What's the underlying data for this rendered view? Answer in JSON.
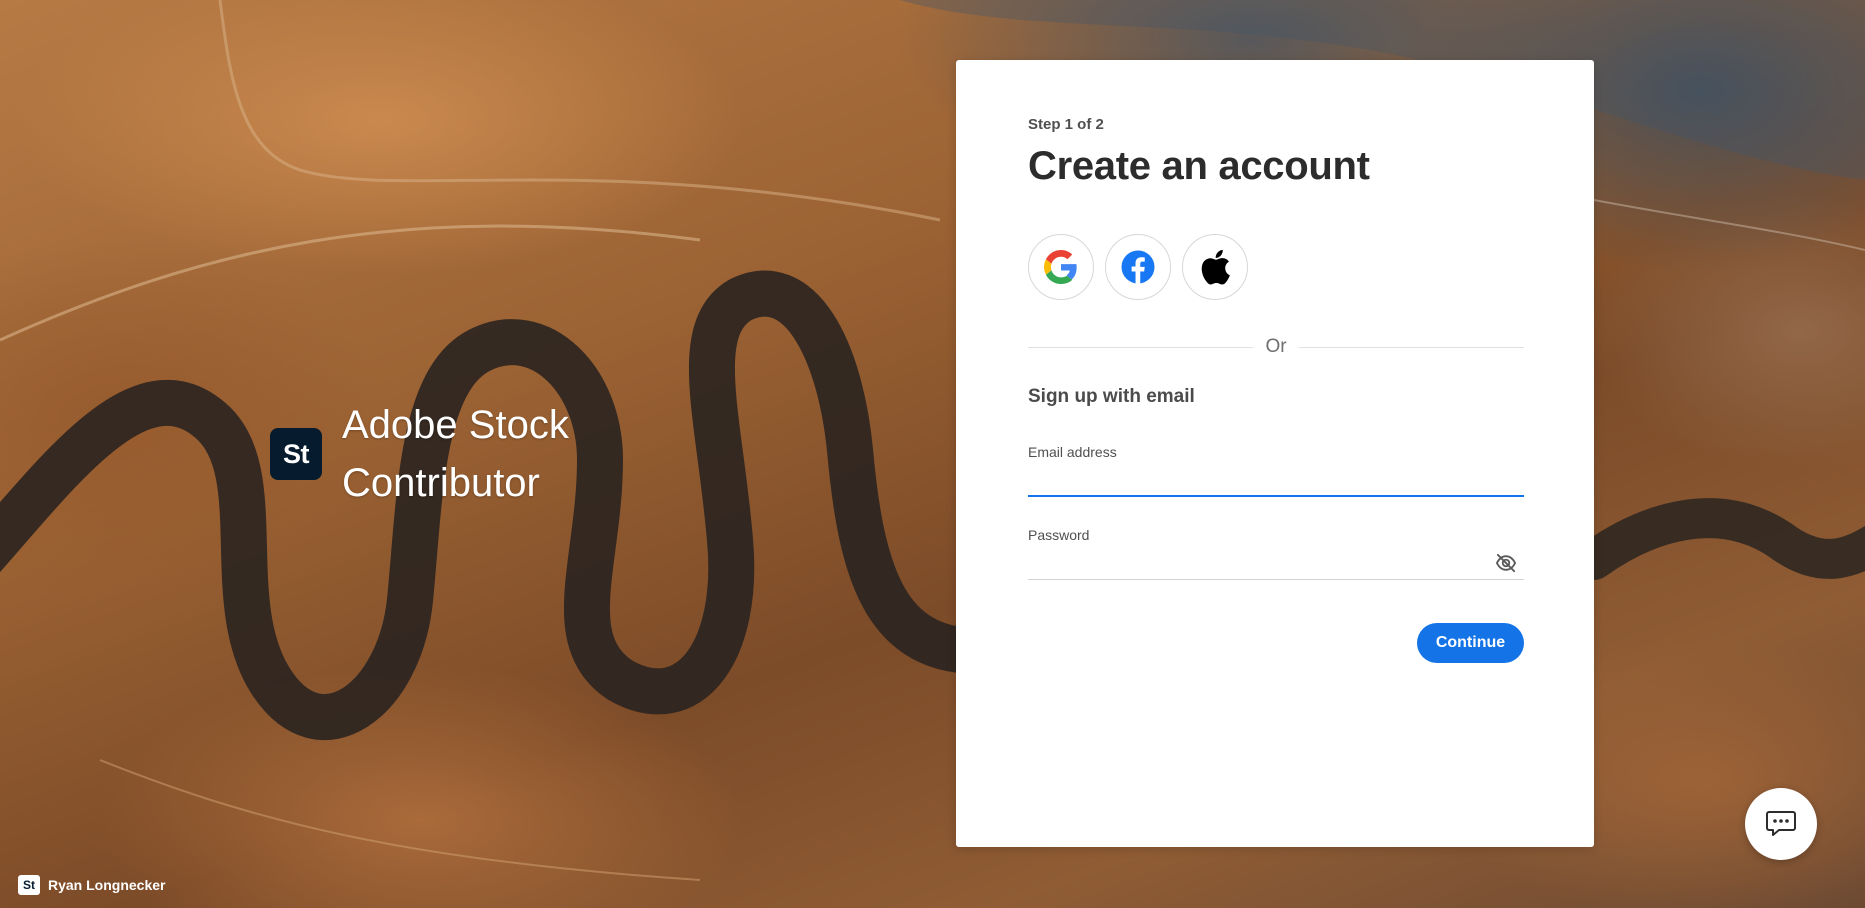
{
  "brand": {
    "logo_text": "St",
    "name_line1": "Adobe Stock",
    "name_line2": "Contributor"
  },
  "credit": {
    "logo_text": "St",
    "photographer": "Ryan Longnecker"
  },
  "form": {
    "step": "Step 1 of 2",
    "title": "Create an account",
    "social_buttons": [
      {
        "icon": "google-icon"
      },
      {
        "icon": "facebook-icon"
      },
      {
        "icon": "apple-icon"
      }
    ],
    "divider_text": "Or",
    "signup_heading": "Sign up with email",
    "email": {
      "label": "Email address",
      "value": "",
      "placeholder": ""
    },
    "password": {
      "label": "Password",
      "value": "",
      "placeholder": ""
    },
    "password_toggle_icon": "eye-off-icon",
    "continue_label": "Continue"
  },
  "chat_icon": "chat-icon",
  "colors": {
    "accent": "#1473e6",
    "logo_bg": "#061c2e",
    "card_bg": "#ffffff",
    "facebook": "#1877f2"
  }
}
